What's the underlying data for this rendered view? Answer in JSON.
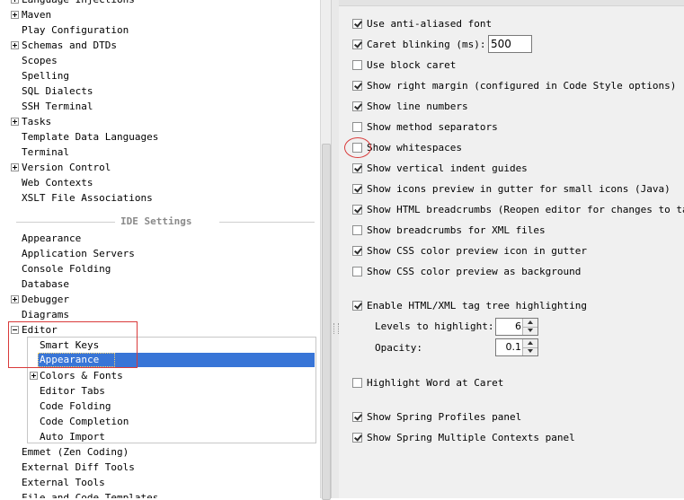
{
  "left_tree": {
    "top_items": [
      {
        "label": "Language Injections",
        "expander": true
      },
      {
        "label": "Maven",
        "expander": true
      },
      {
        "label": "Play Configuration",
        "expander": false
      },
      {
        "label": "Schemas and DTDs",
        "expander": true
      },
      {
        "label": "Scopes",
        "expander": false
      },
      {
        "label": "Spelling",
        "expander": false
      },
      {
        "label": "SQL Dialects",
        "expander": false
      },
      {
        "label": "SSH Terminal",
        "expander": false
      },
      {
        "label": "Tasks",
        "expander": true
      },
      {
        "label": "Template Data Languages",
        "expander": false
      },
      {
        "label": "Terminal",
        "expander": false
      },
      {
        "label": "Version Control",
        "expander": true
      },
      {
        "label": "Web Contexts",
        "expander": false
      },
      {
        "label": "XSLT File Associations",
        "expander": false
      }
    ],
    "section_title": "IDE Settings",
    "ide_items": [
      {
        "label": "Appearance",
        "expander": false
      },
      {
        "label": "Application Servers",
        "expander": false
      },
      {
        "label": "Console Folding",
        "expander": false
      },
      {
        "label": "Database",
        "expander": false
      },
      {
        "label": "Debugger",
        "expander": true
      },
      {
        "label": "Diagrams",
        "expander": false
      },
      {
        "label": "Editor",
        "expander": "minus"
      }
    ],
    "editor_children": [
      {
        "label": "Smart Keys",
        "expander": false
      },
      {
        "label": "Appearance",
        "expander": false,
        "selected": true
      },
      {
        "label": "Colors & Fonts",
        "expander": true
      },
      {
        "label": "Editor Tabs",
        "expander": false
      },
      {
        "label": "Code Folding",
        "expander": false
      },
      {
        "label": "Code Completion",
        "expander": false
      },
      {
        "label": "Auto Import",
        "expander": false
      }
    ],
    "bottom_items": [
      {
        "label": "Emmet (Zen Coding)",
        "expander": false
      },
      {
        "label": "External Diff Tools",
        "expander": false
      },
      {
        "label": "External Tools",
        "expander": false
      },
      {
        "label": "File and Code Templates",
        "expander": false
      }
    ]
  },
  "right_options": {
    "anti_aliased": {
      "label": "Use anti-aliased font",
      "checked": true
    },
    "caret_blinking": {
      "label": "Caret blinking (ms):",
      "checked": true,
      "value": "500"
    },
    "block_caret": {
      "label": "Use block caret",
      "checked": false
    },
    "right_margin": {
      "label": "Show right margin (configured in Code Style options)",
      "checked": true
    },
    "line_numbers": {
      "label": "Show line numbers",
      "checked": true
    },
    "method_separators": {
      "label": "Show method separators",
      "checked": false
    },
    "whitespaces": {
      "label": "Show whitespaces",
      "checked": false
    },
    "indent_guides": {
      "label": "Show vertical indent guides",
      "checked": true
    },
    "icons_preview": {
      "label": "Show icons preview in gutter for small icons (Java)",
      "checked": true
    },
    "html_breadcrumbs": {
      "label": "Show HTML breadcrumbs (Reopen editor for changes to take ef",
      "checked": true
    },
    "xml_breadcrumbs": {
      "label": "Show breadcrumbs for XML files",
      "checked": false
    },
    "css_gutter": {
      "label": "Show CSS color preview icon in gutter",
      "checked": true
    },
    "css_background": {
      "label": "Show CSS color preview as background",
      "checked": false
    },
    "tag_tree": {
      "label": "Enable HTML/XML tag tree highlighting",
      "checked": true
    },
    "levels_label": "Levels to highlight:",
    "levels_value": "6",
    "opacity_label": "Opacity:",
    "opacity_value": "0.1",
    "highlight_word": {
      "label": "Highlight Word at Caret",
      "checked": false
    },
    "spring_profiles": {
      "label": "Show Spring Profiles panel",
      "checked": true
    },
    "spring_contexts": {
      "label": "Show Spring Multiple Contexts panel",
      "checked": true
    }
  }
}
